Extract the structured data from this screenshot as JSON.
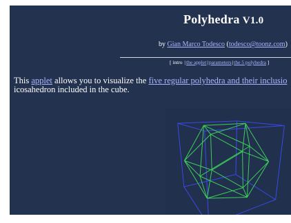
{
  "header": {
    "title": "Polyhedra",
    "version": "V1.0",
    "by_prefix": "by",
    "author": "Gian Marco Todesco",
    "email": "todesco@toonz.com",
    "open_paren": "(",
    "close_paren": ")"
  },
  "nav": {
    "open_bracket": "[",
    "close_bracket": "]",
    "separator": "|",
    "items": [
      {
        "label": "intro",
        "is_link": false
      },
      {
        "label": "the applet",
        "is_link": true
      },
      {
        "label": "parameters",
        "is_link": true
      },
      {
        "label": "the 5 polyhedra",
        "is_link": true
      }
    ]
  },
  "intro": {
    "text_before": "This",
    "applet_link": "applet",
    "text_mid": "allows you to visualize the",
    "polyhedra_link": "five regular polyhedra and their inclusio",
    "line2": "icosahedron included in the cube."
  },
  "colors": {
    "background": "#23324f",
    "link": "#aab6ff",
    "cube_edges": "#3b49e8",
    "icosahedron_edges": "#3fcf5a"
  }
}
